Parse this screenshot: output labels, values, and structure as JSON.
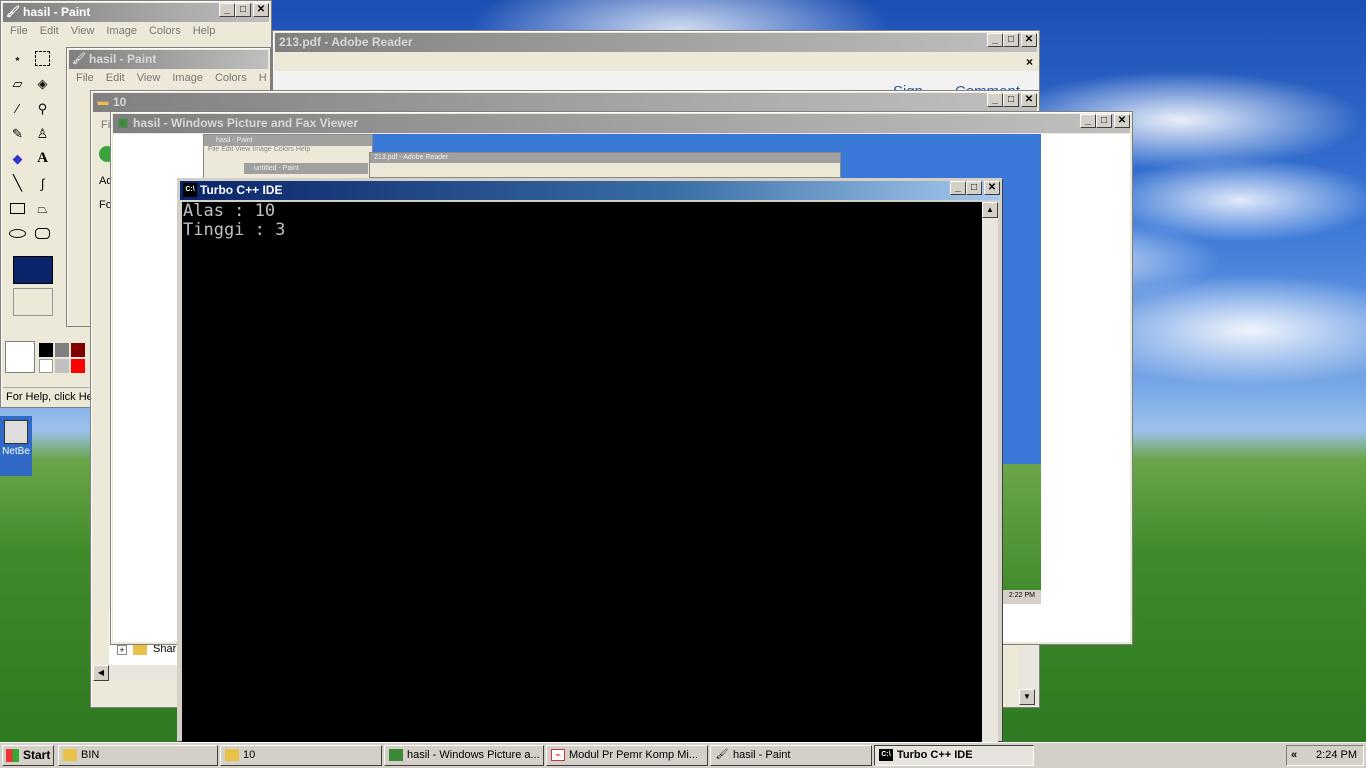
{
  "paint_back": {
    "title": "hasil - Paint",
    "menu": [
      "File",
      "Edit",
      "View",
      "Image",
      "Colors",
      "Help"
    ],
    "status": "For Help, click He"
  },
  "paint_inner": {
    "title": "hasil - Paint",
    "menu": [
      "File",
      "Edit",
      "View",
      "Image",
      "Colors",
      "H"
    ]
  },
  "adobe": {
    "title": "213.pdf - Adobe Reader",
    "sign": "Sign",
    "comment": "Comment"
  },
  "explorer": {
    "title": "10",
    "frag_menu": "Fi",
    "frag_addr": "Ad",
    "frag_folders": "Fo",
    "tree_item": "Shar"
  },
  "viewer": {
    "title": "hasil - Windows Picture and Fax Viewer",
    "thumb_paint_title": "hasil - Paint",
    "thumb_untitled": "untitled - Paint",
    "thumb_adobe": "213.pdf - Adobe Reader",
    "thumb_clock": "2:22 PM",
    "thumb_menu": [
      "File",
      "Edit",
      "View",
      "Image",
      "Colors",
      "Help"
    ]
  },
  "desktop": {
    "icon_label": "NetBe"
  },
  "turbo": {
    "title": "Turbo C++ IDE",
    "console_lines": [
      "Alas : 10",
      "Tinggi : 3"
    ]
  },
  "taskbar": {
    "start": "Start",
    "tasks": [
      {
        "label": "BIN",
        "icon": "folder-icon"
      },
      {
        "label": "10",
        "icon": "folder-icon"
      },
      {
        "label": "hasil - Windows Picture a...",
        "icon": "picture-viewer-icon"
      },
      {
        "label": "Modul  Pr  Pemr Komp Mi...",
        "icon": "pdf-icon"
      },
      {
        "label": "hasil - Paint",
        "icon": "paint-icon"
      },
      {
        "label": "Turbo C++ IDE",
        "icon": "console-icon"
      }
    ],
    "tray_arrow": "«",
    "clock": "2:24 PM"
  }
}
